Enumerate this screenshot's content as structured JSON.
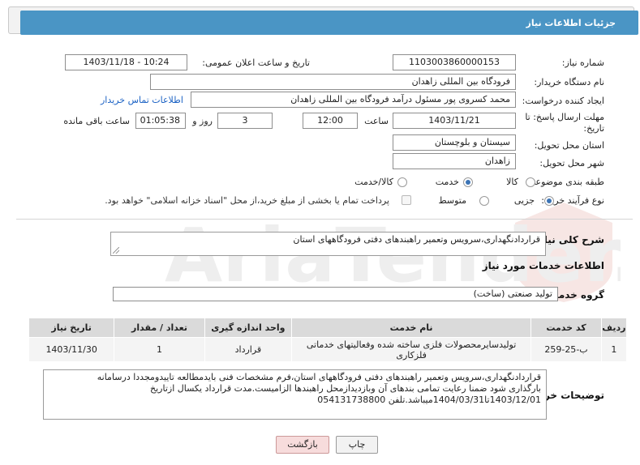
{
  "header": {
    "title": "جزئیات اطلاعات نیاز"
  },
  "form": {
    "need_number_label": "شماره نیاز:",
    "need_number": "1103003860000153",
    "announce_label": "تاریخ و ساعت اعلان عمومی:",
    "announce_value": "1403/11/18 - 10:24",
    "buyer_org_label": "نام دستگاه خریدار:",
    "buyer_org": "فرودگاه بین المللی زاهدان",
    "requester_label": "ایجاد کننده درخواست:",
    "requester": "محمد کسروی پور مسئول درآمد فرودگاه بین المللی زاهدان",
    "contact_link": "اطلاعات تماس خریدار",
    "deadline_label": "مهلت ارسال پاسخ: تا تاریخ:",
    "deadline_date": "1403/11/21",
    "time_label": "ساعت",
    "deadline_time": "12:00",
    "days_value": "3",
    "days_label": "روز و",
    "remaining_time": "01:05:38",
    "remaining_label": "ساعت باقی مانده",
    "province_label": "استان محل تحویل:",
    "province": "سیستان و بلوچستان",
    "city_label": "شهر محل تحویل:",
    "city": "زاهدان",
    "category_label": "طبقه بندی موضوعی:",
    "category_options": [
      "کالا",
      "خدمت",
      "کالا/خدمت"
    ],
    "category_selected": "خدمت",
    "process_label": "نوع فرآیند خرید :",
    "process_options": [
      "جزیی",
      "متوسط"
    ],
    "process_selected": "جزیی",
    "treasury_note": "پرداخت تمام یا بخشی از مبلغ خرید،از محل \"اسناد خزانه اسلامی\" خواهد بود."
  },
  "summary": {
    "label": "شرح کلی نیاز:",
    "text": "قراردادنگهداری،سرویس وتعمیر راهبندهای دفتی فرودگاههای استان"
  },
  "services": {
    "section_title": "اطلاعات خدمات مورد نیاز",
    "group_label": "گروه خدمت:",
    "group_value": "تولید صنعتی (ساخت)",
    "columns": [
      "ردیف",
      "کد خدمت",
      "نام خدمت",
      "واحد اندازه گیری",
      "تعداد / مقدار",
      "تاریخ نیاز"
    ],
    "rows": [
      {
        "index": "1",
        "code": "ب-25-259",
        "name_line1": "تولیدسایرمحصولات فلزی ساخته شده وفعالیتهای خدماتی",
        "name_line2": "فلزکاری",
        "unit": "قرارداد",
        "qty": "1",
        "date": "1403/11/30"
      }
    ]
  },
  "buyer_notes": {
    "label": "توضیحات خریدار:",
    "line1": "قراردادنگهداری،سرویس وتعمیر راهبندهای دفتی فرودگاههای استان،فرم مشخصات فنی بایدمطالعه تاییدومجددا درسامانه",
    "line2": "بارگذاری شود ضمنا رعایت تمامی بندهای آن وبازدیدازمحل راهبندها الزامیست.مدت قرارداد یکسال ازتاریخ",
    "line3": "1403/12/01تا1404/03/31میباشد.تلفن 054131738800"
  },
  "buttons": {
    "print": "چاپ",
    "back": "بازگشت"
  },
  "watermark": {
    "text": "AriaTender.neT"
  },
  "colors": {
    "header_bar": "#4a95c5",
    "link": "#1b62c4",
    "back_button": "#f7dcdc"
  }
}
